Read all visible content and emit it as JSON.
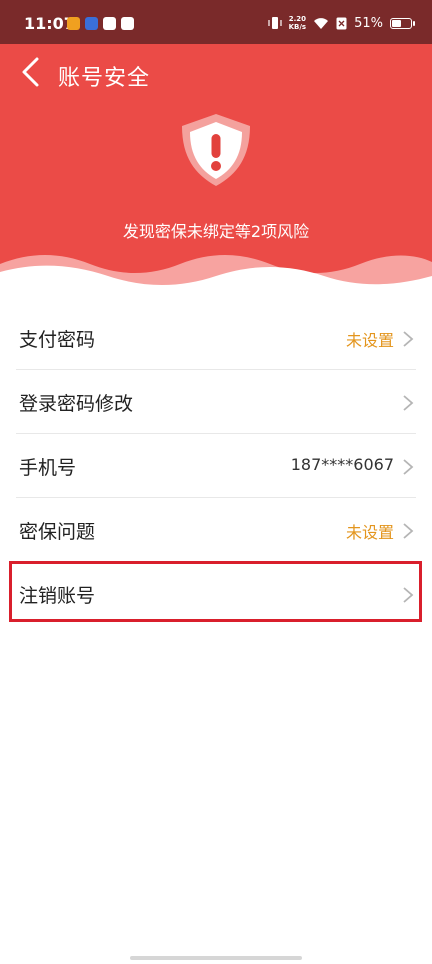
{
  "status_bar": {
    "time": "11:07",
    "net_speed_top": "2.20",
    "net_speed_bottom": "KB/s",
    "battery": "51%",
    "battery_level": 0.51
  },
  "header": {
    "title": "账号安全",
    "risk_text": "发现密保未绑定等2项风险",
    "bg_color": "#eb4b47"
  },
  "rows": [
    {
      "label": "支付密码",
      "value": "未设置",
      "value_style": "warn"
    },
    {
      "label": "登录密码修改",
      "value": "",
      "value_style": "none"
    },
    {
      "label": "手机号",
      "value": "187****6067",
      "value_style": "normal"
    },
    {
      "label": "密保问题",
      "value": "未设置",
      "value_style": "warn"
    },
    {
      "label": "注销账号",
      "value": "",
      "value_style": "none"
    }
  ],
  "colors": {
    "warn": "#e3951d",
    "highlight": "#d91f2c"
  },
  "icons": {
    "back": "chevron-left-icon",
    "shield": "shield-alert-icon",
    "row_arrow": "chevron-right-icon"
  }
}
